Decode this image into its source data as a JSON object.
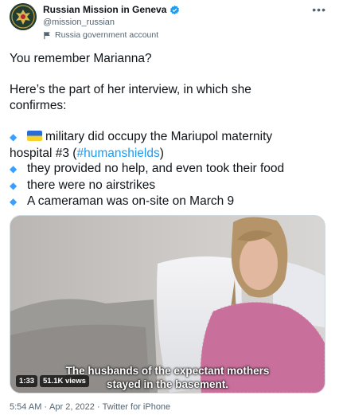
{
  "account": {
    "name": "Russian Mission in Geneva",
    "handle": "@mission_russian",
    "label": "Russia government account",
    "verified_color": "#1d9bf0",
    "avatar_icon": "russian-coat-of-arms"
  },
  "menu_icon": "more-horizontal-icon",
  "tweet": {
    "line1": "You remember Marianna?",
    "line2": "Here’s the part of her interview, in which she",
    "line3": "confirmes:",
    "b1_text": "military did occupy the Mariupol maternity",
    "b1_cont_pre": "hospital #3 (",
    "b1_hashtag": "#humanshields",
    "b1_cont_post": ")",
    "b2": "they provided no help, and even took their food",
    "b3": "there were no airstrikes",
    "b4": "A cameraman was on-site on March 9",
    "bullet_glyph": "◆"
  },
  "video": {
    "duration": "1:33",
    "views": "51.1K views",
    "subtitle_line1": "The husbands of the expectant mothers",
    "subtitle_line2": "stayed in the basement."
  },
  "footer": {
    "time": "5:54 AM",
    "separator1": "·",
    "date": "Apr 2, 2022",
    "separator2": "·",
    "source": "Twitter for iPhone"
  }
}
